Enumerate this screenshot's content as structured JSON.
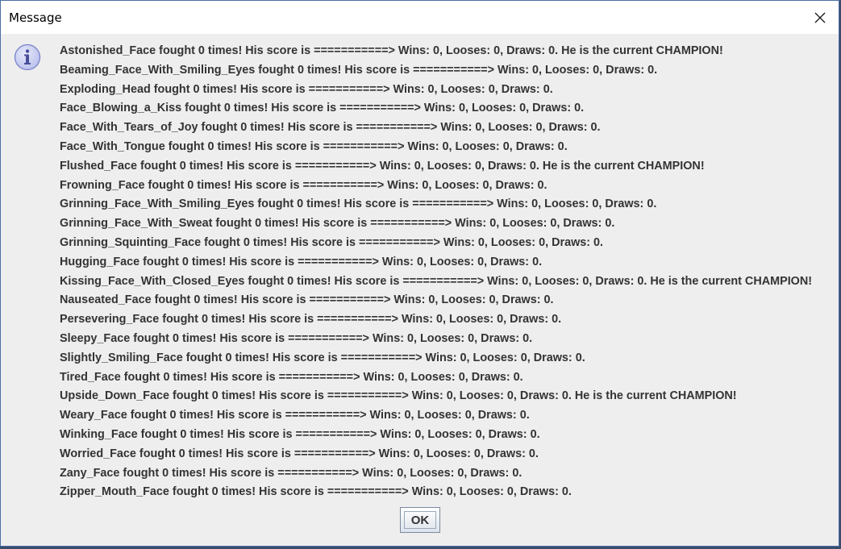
{
  "window": {
    "title": "Message"
  },
  "icons": {
    "close": "close-icon",
    "info": "info-icon"
  },
  "messages": [
    "Astonished_Face fought 0 times! His score is ===========> Wins: 0, Looses: 0, Draws: 0. He is the current CHAMPION!",
    "Beaming_Face_With_Smiling_Eyes fought 0 times! His score is ===========> Wins: 0, Looses: 0, Draws: 0.",
    "Exploding_Head fought 0 times! His score is ===========> Wins: 0, Looses: 0, Draws: 0.",
    "Face_Blowing_a_Kiss fought 0 times! His score is ===========> Wins: 0, Looses: 0, Draws: 0.",
    "Face_With_Tears_of_Joy fought 0 times! His score is ===========> Wins: 0, Looses: 0, Draws: 0.",
    "Face_With_Tongue fought 0 times! His score is ===========> Wins: 0, Looses: 0, Draws: 0.",
    "Flushed_Face fought 0 times! His score is ===========> Wins: 0, Looses: 0, Draws: 0. He is the current CHAMPION!",
    "Frowning_Face fought 0 times! His score is ===========> Wins: 0, Looses: 0, Draws: 0.",
    "Grinning_Face_With_Smiling_Eyes fought 0 times! His score is ===========> Wins: 0, Looses: 0, Draws: 0.",
    "Grinning_Face_With_Sweat fought 0 times! His score is ===========> Wins: 0, Looses: 0, Draws: 0.",
    "Grinning_Squinting_Face fought 0 times! His score is ===========> Wins: 0, Looses: 0, Draws: 0.",
    "Hugging_Face fought 0 times! His score is ===========> Wins: 0, Looses: 0, Draws: 0.",
    "Kissing_Face_With_Closed_Eyes fought 0 times! His score is ===========> Wins: 0, Looses: 0, Draws: 0. He is the current CHAMPION!",
    "Nauseated_Face fought 0 times! His score is ===========> Wins: 0, Looses: 0, Draws: 0.",
    "Persevering_Face fought 0 times! His score is ===========> Wins: 0, Looses: 0, Draws: 0.",
    "Sleepy_Face fought 0 times! His score is ===========> Wins: 0, Looses: 0, Draws: 0.",
    "Slightly_Smiling_Face fought 0 times! His score is ===========> Wins: 0, Looses: 0, Draws: 0.",
    "Tired_Face fought 0 times! His score is ===========> Wins: 0, Looses: 0, Draws: 0.",
    "Upside_Down_Face fought 0 times! His score is ===========> Wins: 0, Looses: 0, Draws: 0. He is the current CHAMPION!",
    "Weary_Face fought 0 times! His score is ===========> Wins: 0, Looses: 0, Draws: 0.",
    "Winking_Face fought 0 times! His score is ===========> Wins: 0, Looses: 0, Draws: 0.",
    "Worried_Face fought 0 times! His score is ===========> Wins: 0, Looses: 0, Draws: 0.",
    "Zany_Face fought 0 times! His score is ===========> Wins: 0, Looses: 0, Draws: 0.",
    "Zipper_Mouth_Face fought 0 times! His score is ===========> Wins: 0, Looses: 0, Draws: 0."
  ],
  "buttons": {
    "ok_label": "OK"
  },
  "colors": {
    "title_bar": "#ffffff",
    "dialog_bg": "#eeeeee",
    "text": "#333333",
    "info_icon_fill": "#c7cdf0",
    "info_icon_stroke": "#7a82c9"
  }
}
